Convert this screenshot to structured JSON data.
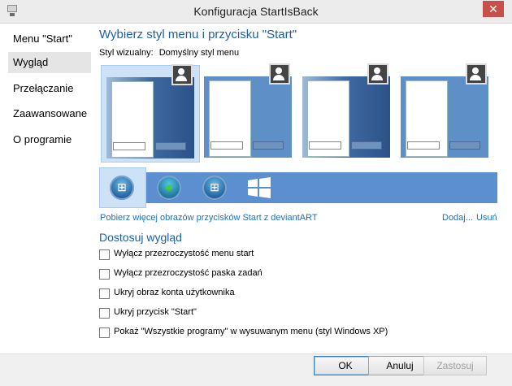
{
  "window": {
    "title": "Konfiguracja StartIsBack",
    "close_glyph": "✕",
    "app_icon": "computer-icon"
  },
  "sidebar": {
    "items": [
      {
        "label": "Menu \"Start\""
      },
      {
        "label": "Wygląd"
      },
      {
        "label": "Przełączanie"
      },
      {
        "label": "Zaawansowane"
      },
      {
        "label": "O programie"
      }
    ]
  },
  "main": {
    "title": "Wybierz styl menu i przycisku \"Start\"",
    "visual_style_label": "Styl wizualny:",
    "visual_style_value": "Domyślny styl menu",
    "link_more": "Pobierz więcej obrazów przycisków Start z deviantART",
    "link_add": "Dodaj...",
    "link_remove": "Usuń",
    "customize_title": "Dostosuj wygląd",
    "options": [
      {
        "label": "Wyłącz przezroczystość menu start",
        "checked": false
      },
      {
        "label": "Wyłącz przezroczystość paska zadań",
        "checked": false
      },
      {
        "label": "Ukryj obraz konta użytkownika",
        "checked": false
      },
      {
        "label": "Ukryj przycisk \"Start\"",
        "checked": false
      },
      {
        "label": "Pokaż \"Wszystkie programy\" w wysuwanym menu (styl Windows XP)",
        "checked": false
      }
    ]
  },
  "footer": {
    "ok": "OK",
    "cancel": "Anuluj",
    "apply": "Zastosuj"
  },
  "colors": {
    "accent": "#1c5fa8",
    "link": "#1c6fc8",
    "strip": "#5b8fcf",
    "close": "#c7504b"
  }
}
